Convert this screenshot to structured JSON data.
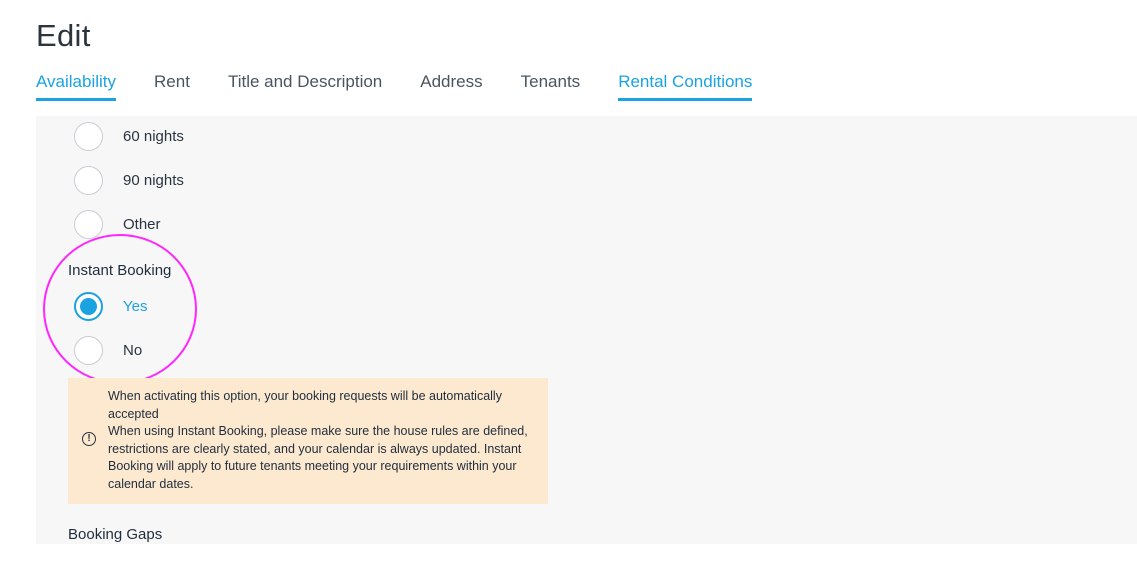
{
  "header": {
    "title": "Edit"
  },
  "tabs": [
    {
      "label": "Availability",
      "active": true
    },
    {
      "label": "Rent",
      "active": false
    },
    {
      "label": "Title and Description",
      "active": false
    },
    {
      "label": "Address",
      "active": false
    },
    {
      "label": "Tenants",
      "active": false
    },
    {
      "label": "Rental Conditions",
      "active": true
    }
  ],
  "min_stay_options": [
    {
      "label": "60 nights",
      "checked": false
    },
    {
      "label": "90 nights",
      "checked": false
    },
    {
      "label": "Other",
      "checked": false
    }
  ],
  "instant_booking": {
    "label": "Instant Booking",
    "options": [
      {
        "label": "Yes",
        "checked": true
      },
      {
        "label": "No",
        "checked": false
      }
    ],
    "notice": {
      "icon": "alert-circle-icon",
      "headline": "When activating this option, your booking requests will be automatically accepted",
      "body": "When using Instant Booking, please make sure the house rules are defined, restrictions are clearly stated, and your calendar is always updated. Instant Booking will apply to future tenants meeting your requirements within your calendar dates."
    }
  },
  "booking_gaps": {
    "label": "Booking Gaps"
  },
  "colors": {
    "accent": "#1aa3e0",
    "highlight": "#ff26ff",
    "notice_bg": "#fde9cf",
    "panel_bg": "#f7f7f7"
  }
}
